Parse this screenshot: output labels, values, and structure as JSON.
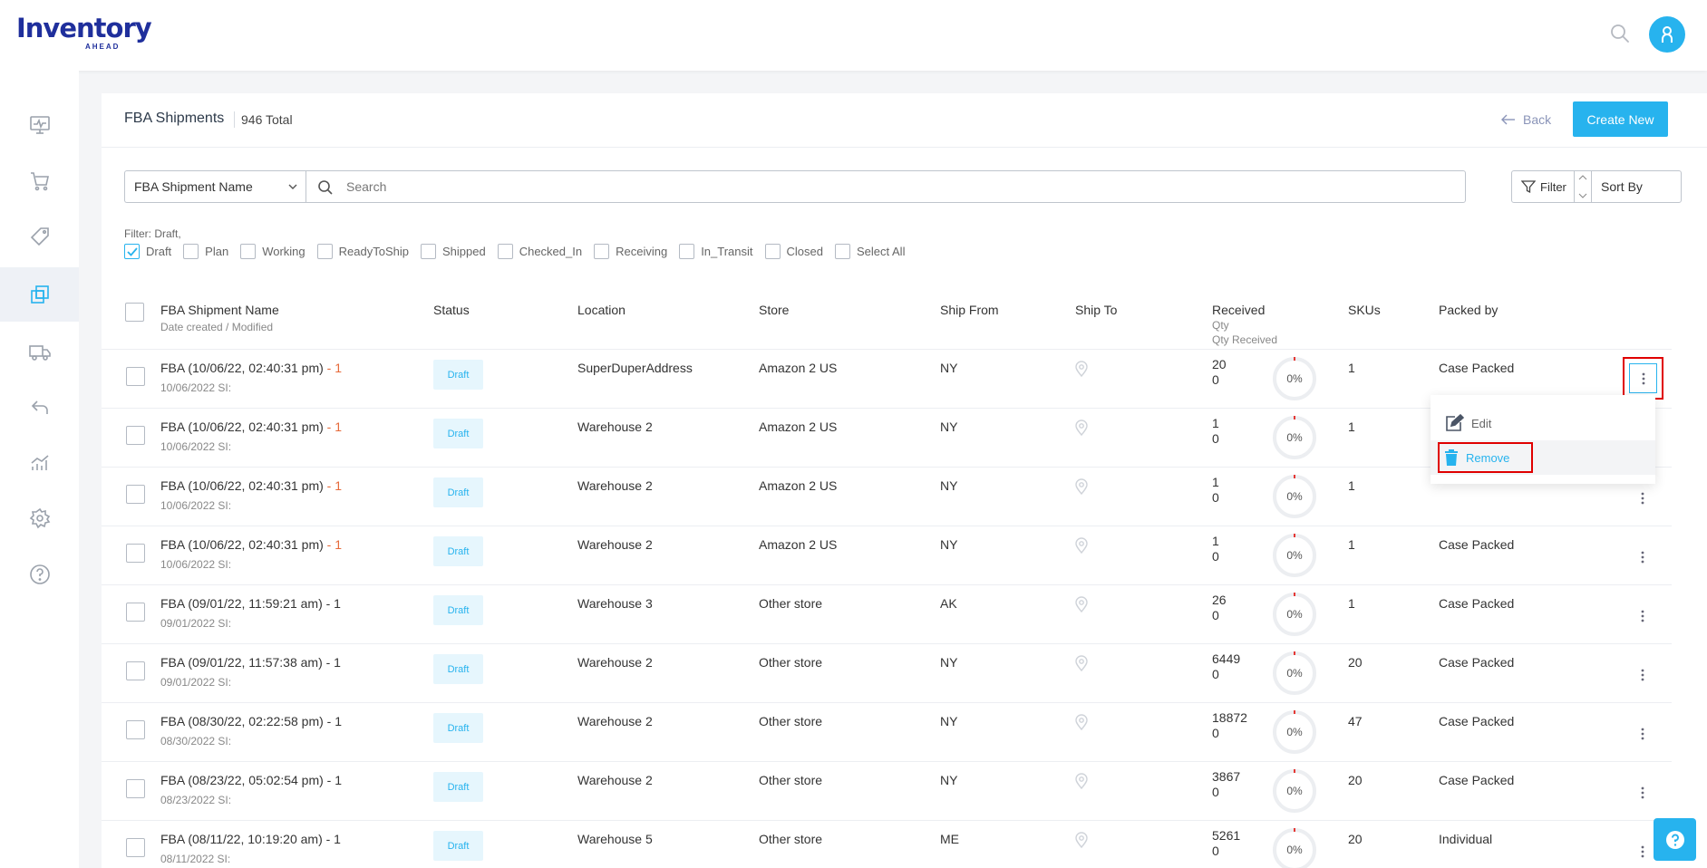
{
  "app": {
    "logo_main": "Inventory",
    "logo_sub": "AHEAD"
  },
  "icons": {
    "search": "search-icon",
    "user": "user-icon",
    "help": "help-icon"
  },
  "colors": {
    "accent": "#27b3ee",
    "brand": "#1f2f9c",
    "draft_bg": "#e6f6fd",
    "highlight": "#e00000",
    "suffix": "#e66a3a"
  },
  "sidebar": {
    "items": [
      {
        "icon": "dashboard-icon"
      },
      {
        "icon": "cart-icon"
      },
      {
        "icon": "tag-icon"
      },
      {
        "icon": "shipments-icon",
        "active": true
      },
      {
        "icon": "truck-icon"
      },
      {
        "icon": "return-icon"
      },
      {
        "icon": "chart-icon"
      },
      {
        "icon": "gear-icon"
      },
      {
        "icon": "question-icon"
      }
    ]
  },
  "header": {
    "title": "FBA Shipments",
    "count": "946 Total",
    "back": "Back",
    "create": "Create New"
  },
  "search": {
    "select_value": "FBA Shipment Name",
    "placeholder": "Search",
    "filter": "Filter",
    "sort": "Sort By"
  },
  "filter": {
    "label": "Filter: Draft,",
    "options": [
      {
        "label": "Draft",
        "checked": true
      },
      {
        "label": "Plan",
        "checked": false
      },
      {
        "label": "Working",
        "checked": false
      },
      {
        "label": "ReadyToShip",
        "checked": false
      },
      {
        "label": "Shipped",
        "checked": false
      },
      {
        "label": "Checked_In",
        "checked": false
      },
      {
        "label": "Receiving",
        "checked": false
      },
      {
        "label": "In_Transit",
        "checked": false
      },
      {
        "label": "Closed",
        "checked": false
      },
      {
        "label": "Select All",
        "checked": false
      }
    ]
  },
  "table": {
    "headers": {
      "name": "FBA Shipment Name",
      "name_sub": "Date created / Modified",
      "status": "Status",
      "location": "Location",
      "store": "Store",
      "ship_from": "Ship From",
      "ship_to": "Ship To",
      "received": "Received",
      "received_sub1": "Qty",
      "received_sub2": "Qty Received",
      "skus": "SKUs",
      "packed": "Packed by"
    },
    "rows": [
      {
        "name": "FBA (10/06/22, 02:40:31 pm)",
        "suffix": " - 1",
        "date": "10/06/2022 SI:",
        "status": "Draft",
        "location": "SuperDuperAddress",
        "store": "Amazon 2 US",
        "ship_from": "NY",
        "qty": "20",
        "qty_received": "0",
        "percent": "0%",
        "skus": "1",
        "packed": "Case Packed"
      },
      {
        "name": "FBA (10/06/22, 02:40:31 pm)",
        "suffix": " - 1",
        "date": "10/06/2022 SI:",
        "status": "Draft",
        "location": "Warehouse 2",
        "store": "Amazon 2 US",
        "ship_from": "NY",
        "qty": "1",
        "qty_received": "0",
        "percent": "0%",
        "skus": "1",
        "packed": ""
      },
      {
        "name": "FBA (10/06/22, 02:40:31 pm)",
        "suffix": " - 1",
        "date": "10/06/2022 SI:",
        "status": "Draft",
        "location": "Warehouse 2",
        "store": "Amazon 2 US",
        "ship_from": "NY",
        "qty": "1",
        "qty_received": "0",
        "percent": "0%",
        "skus": "1",
        "packed": ""
      },
      {
        "name": "FBA (10/06/22, 02:40:31 pm)",
        "suffix": " - 1",
        "date": "10/06/2022 SI:",
        "status": "Draft",
        "location": "Warehouse 2",
        "store": "Amazon 2 US",
        "ship_from": "NY",
        "qty": "1",
        "qty_received": "0",
        "percent": "0%",
        "skus": "1",
        "packed": "Case Packed"
      },
      {
        "name": "FBA (09/01/22, 11:59:21 am) - 1",
        "suffix": "",
        "date": "09/01/2022 SI:",
        "status": "Draft",
        "location": "Warehouse 3",
        "store": "Other store",
        "ship_from": "AK",
        "qty": "26",
        "qty_received": "0",
        "percent": "0%",
        "skus": "1",
        "packed": "Case Packed"
      },
      {
        "name": "FBA (09/01/22, 11:57:38 am) - 1",
        "suffix": "",
        "date": "09/01/2022 SI:",
        "status": "Draft",
        "location": "Warehouse 2",
        "store": "Other store",
        "ship_from": "NY",
        "qty": "6449",
        "qty_received": "0",
        "percent": "0%",
        "skus": "20",
        "packed": "Case Packed"
      },
      {
        "name": "FBA (08/30/22, 02:22:58 pm) - 1",
        "suffix": "",
        "date": "08/30/2022 SI:",
        "status": "Draft",
        "location": "Warehouse 2",
        "store": "Other store",
        "ship_from": "NY",
        "qty": "18872",
        "qty_received": "0",
        "percent": "0%",
        "skus": "47",
        "packed": "Case Packed"
      },
      {
        "name": "FBA (08/23/22, 05:02:54 pm) - 1",
        "suffix": "",
        "date": "08/23/2022 SI:",
        "status": "Draft",
        "location": "Warehouse 2",
        "store": "Other store",
        "ship_from": "NY",
        "qty": "3867",
        "qty_received": "0",
        "percent": "0%",
        "skus": "20",
        "packed": "Case Packed"
      },
      {
        "name": "FBA (08/11/22, 10:19:20 am) - 1",
        "suffix": "",
        "date": "08/11/2022 SI:",
        "status": "Draft",
        "location": "Warehouse 5",
        "store": "Other store",
        "ship_from": "ME",
        "qty": "5261",
        "qty_received": "0",
        "percent": "0%",
        "skus": "20",
        "packed": "Individual"
      }
    ]
  },
  "dropdown": {
    "edit": "Edit",
    "remove": "Remove"
  }
}
